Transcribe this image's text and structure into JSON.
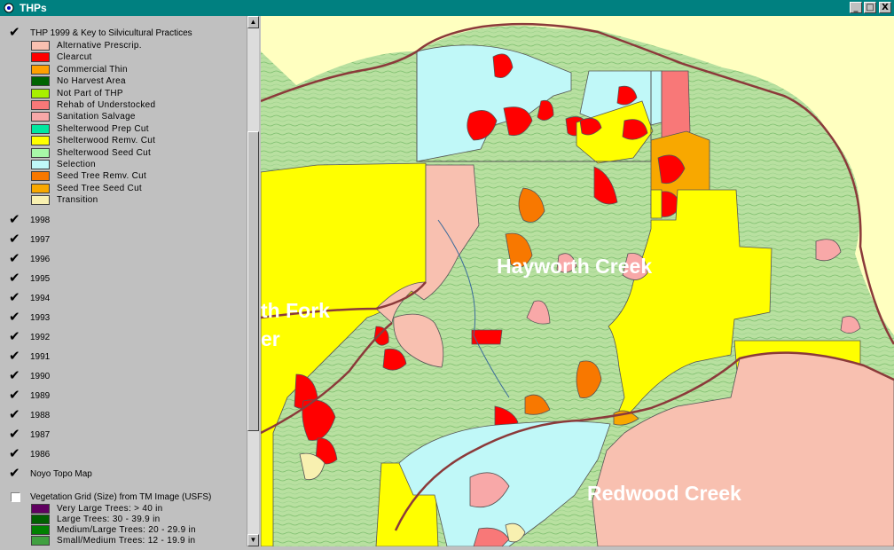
{
  "window": {
    "title": "THPs",
    "minimize_glyph": "_",
    "maximize_glyph": "□",
    "close_glyph": "X"
  },
  "toc": {
    "thp1999": {
      "label": "THP 1999 & Key to Silvicultural Practices",
      "checked": true,
      "legend": [
        {
          "label": "Alternative Prescrip.",
          "color": "#f8c0b0"
        },
        {
          "label": "Clearcut",
          "color": "#ff0000"
        },
        {
          "label": "Commercial Thin",
          "color": "#ffa000"
        },
        {
          "label": "No Harvest Area",
          "color": "#006400"
        },
        {
          "label": "Not Part of THP",
          "color": "#a8f000"
        },
        {
          "label": "Rehab of Understocked",
          "color": "#f87878"
        },
        {
          "label": "Sanitation Salvage",
          "color": "#f8a8a8"
        },
        {
          "label": "Shelterwood Prep Cut",
          "color": "#00e8a0"
        },
        {
          "label": "Shelterwood Remv. Cut",
          "color": "#ffff00"
        },
        {
          "label": "Shelterwood Seed Cut",
          "color": "#a8f8a8"
        },
        {
          "label": "Selection",
          "color": "#c0f8f8"
        },
        {
          "label": "Seed Tree Remv. Cut",
          "color": "#f87800"
        },
        {
          "label": "Seed Tree Seed Cut",
          "color": "#f8a800"
        },
        {
          "label": "Transition",
          "color": "#f8f0b0"
        }
      ]
    },
    "years": [
      {
        "label": "1998",
        "checked": true
      },
      {
        "label": "1997",
        "checked": true
      },
      {
        "label": "1996",
        "checked": true
      },
      {
        "label": "1995",
        "checked": true
      },
      {
        "label": "1994",
        "checked": true
      },
      {
        "label": "1993",
        "checked": true
      },
      {
        "label": "1992",
        "checked": true
      },
      {
        "label": "1991",
        "checked": true
      },
      {
        "label": "1990",
        "checked": true
      },
      {
        "label": "1989",
        "checked": true
      },
      {
        "label": "1988",
        "checked": true
      },
      {
        "label": "1987",
        "checked": true
      },
      {
        "label": "1986",
        "checked": true
      }
    ],
    "topo": {
      "label": "Noyo Topo Map",
      "checked": true
    },
    "vegetation": {
      "label": "Vegetation Grid (Size) from TM Image (USFS)",
      "checked": false,
      "legend": [
        {
          "label": "Very Large Trees: > 40  in",
          "color": "#600060"
        },
        {
          "label": "Large Trees: 30 - 39.9 in",
          "color": "#006000"
        },
        {
          "label": "Medium/Large Trees: 20 - 29.9 in",
          "color": "#008000"
        },
        {
          "label": "Small/Medium Trees: 12 - 19.9 in",
          "color": "#40a040"
        }
      ]
    }
  },
  "map": {
    "labels": {
      "hayworth": "Hayworth Creek",
      "north_fork": "th Fork",
      "north_fork_2": "er",
      "redwood": "Redwood Creek"
    },
    "colors": {
      "background": "#ffffc0",
      "topo": "#b8e0a0",
      "clearcut": "#ff0000",
      "shelterwood_remv": "#ffff00",
      "selection": "#c0f8f8",
      "alternative": "#f8c0b0",
      "seed_tree_remv": "#f87800",
      "boundary": "#8b3a3a"
    }
  }
}
